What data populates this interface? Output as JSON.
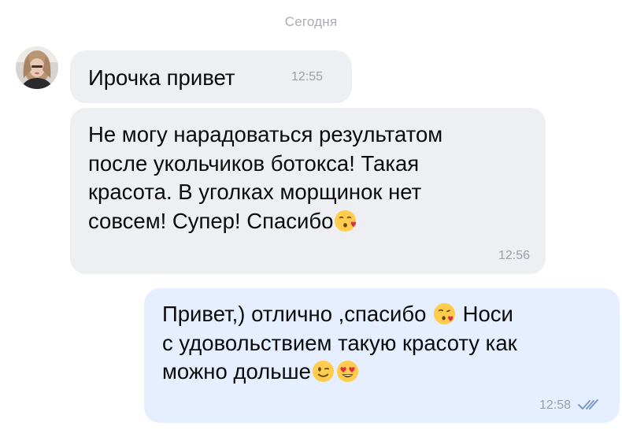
{
  "date_separator": "Сегодня",
  "messages": [
    {
      "direction": "incoming",
      "lines": [
        "Ирочка привет"
      ],
      "time": "12:55"
    },
    {
      "direction": "incoming",
      "lines": [
        "Не могу нарадоваться результатом",
        "после укольчиков ботокса! Такая",
        "красота. В уголках морщинок нет",
        "совсем! Супер! Спасибо"
      ],
      "trailing_emoji": "kissing-face-with-heart-emoji",
      "time": "12:56"
    },
    {
      "direction": "outgoing",
      "line1_pre": "Привет,) отлично ,спасибо ",
      "line1_post": " Носи",
      "line2": "с удовольствием такую красоту как",
      "line3": "можно дольше",
      "emojis": [
        "face-blowing-kiss-emoji",
        "winking-face-emoji",
        "heart-eyes-emoji"
      ],
      "time": "12:58",
      "status": "read-double-check"
    }
  ],
  "colors": {
    "incoming_bubble": "#eeeff2",
    "outgoing_bubble": "#e6efff",
    "timestamp": "#9aa0a8",
    "read_checks": "#7d99c4",
    "date_separator": "#a9adb3"
  }
}
